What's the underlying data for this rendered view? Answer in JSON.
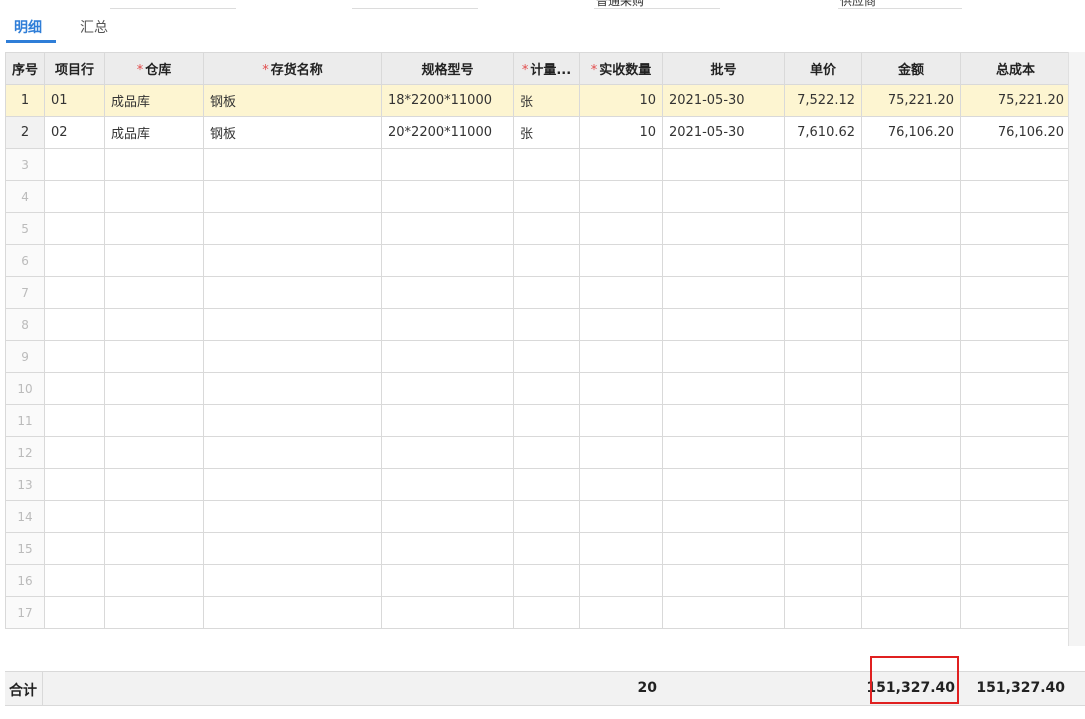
{
  "top_form": {
    "field1_value": "",
    "field3_value": "普通采购",
    "field4_value": "供应商"
  },
  "tabs": {
    "detail": "明细",
    "summary": "汇总"
  },
  "headers": {
    "seq": "序号",
    "item_line": "项目行",
    "warehouse": "仓库",
    "inventory_name": "存货名称",
    "spec": "规格型号",
    "unit": "计量...",
    "qty": "实收数量",
    "batch": "批号",
    "unit_price": "单价",
    "amount": "金额",
    "total_cost": "总成本"
  },
  "rows": [
    {
      "seq": "1",
      "item_line": "01",
      "warehouse": "成品库",
      "inventory_name": "钢板",
      "spec": "18*2200*11000",
      "unit": "张",
      "qty": "10",
      "batch": "2021-05-30",
      "unit_price": "7,522.12",
      "amount": "75,221.20",
      "total_cost": "75,221.20"
    },
    {
      "seq": "2",
      "item_line": "02",
      "warehouse": "成品库",
      "inventory_name": "钢板",
      "spec": "20*2200*11000",
      "unit": "张",
      "qty": "10",
      "batch": "2021-05-30",
      "unit_price": "7,610.62",
      "amount": "76,106.20",
      "total_cost": "76,106.20"
    }
  ],
  "empty_rows": [
    "3",
    "4",
    "5",
    "6",
    "7",
    "8",
    "9",
    "10",
    "11",
    "12",
    "13",
    "14",
    "15",
    "16",
    "17"
  ],
  "footer": {
    "label": "合计",
    "qty_total": "20",
    "amount_total": "151,327.40",
    "cost_total": "151,327.40"
  }
}
